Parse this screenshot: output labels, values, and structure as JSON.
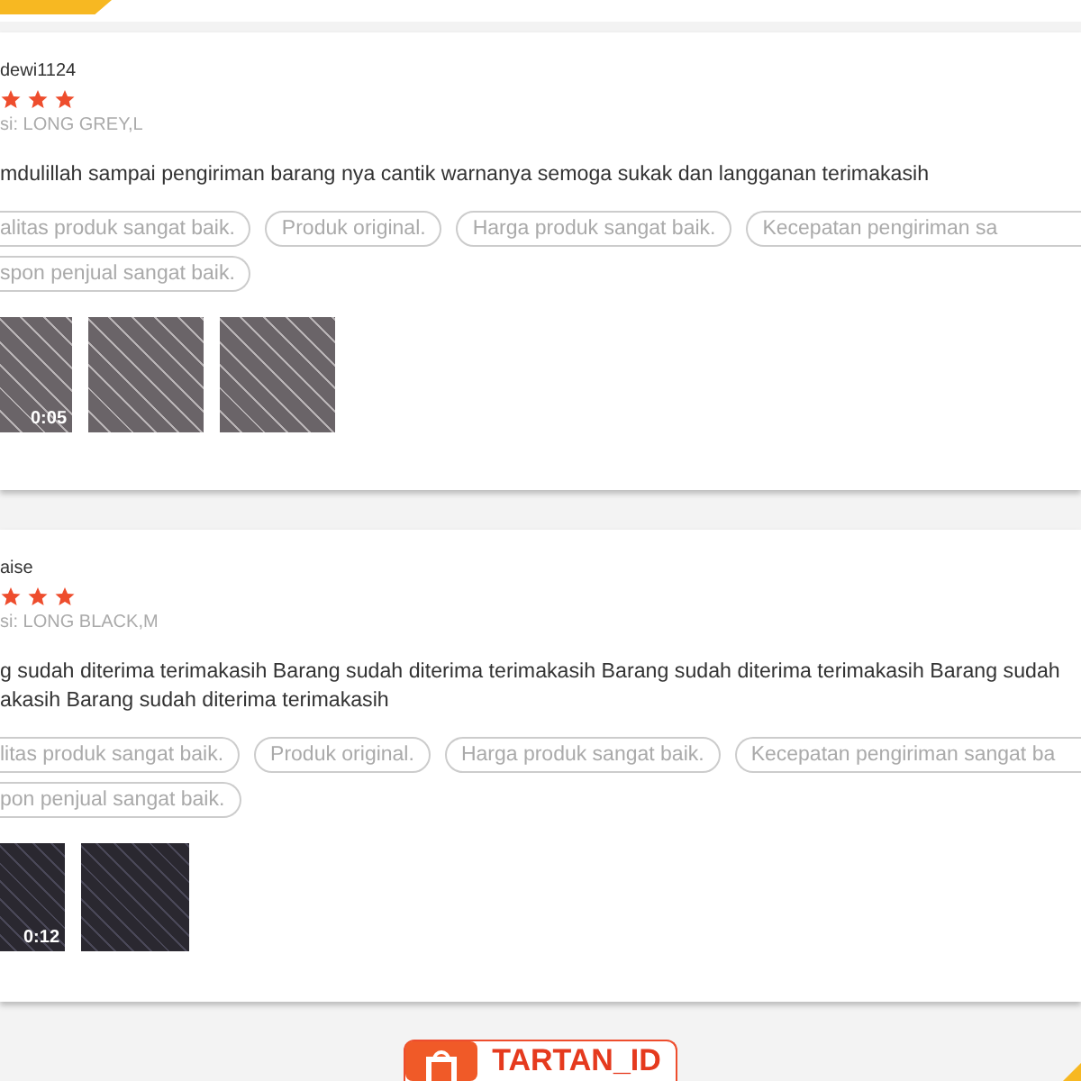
{
  "reviews": [
    {
      "username": "dewi1124",
      "stars": 3,
      "variation": "si: LONG GREY,L",
      "comment": "mdulillah sampai pengiriman barang nya cantik warnanya semoga sukak dan langganan terimakasih",
      "tags": [
        "alitas produk sangat baik.",
        "Produk original.",
        "Harga produk sangat baik.",
        "Kecepatan pengiriman sa",
        "spon penjual sangat baik."
      ],
      "media": [
        {
          "kind": "video",
          "duration": "0:05"
        },
        {
          "kind": "photo"
        },
        {
          "kind": "photo"
        }
      ]
    },
    {
      "username": "aise",
      "stars": 3,
      "variation": "si: LONG BLACK,M",
      "comment": "g sudah diterima terimakasih Barang sudah diterima terimakasih Barang sudah diterima terimakasih Barang sudah",
      "comment_continued": "akasih Barang sudah diterima terimakasih",
      "tags": [
        "litas produk sangat baik.",
        "Produk original.",
        "Harga produk sangat baik.",
        "Kecepatan pengiriman sangat ba",
        "pon penjual sangat baik."
      ],
      "media": [
        {
          "kind": "video",
          "duration": "0:12"
        },
        {
          "kind": "photo"
        }
      ]
    }
  ],
  "footer": {
    "brand": "TARTAN_ID"
  }
}
